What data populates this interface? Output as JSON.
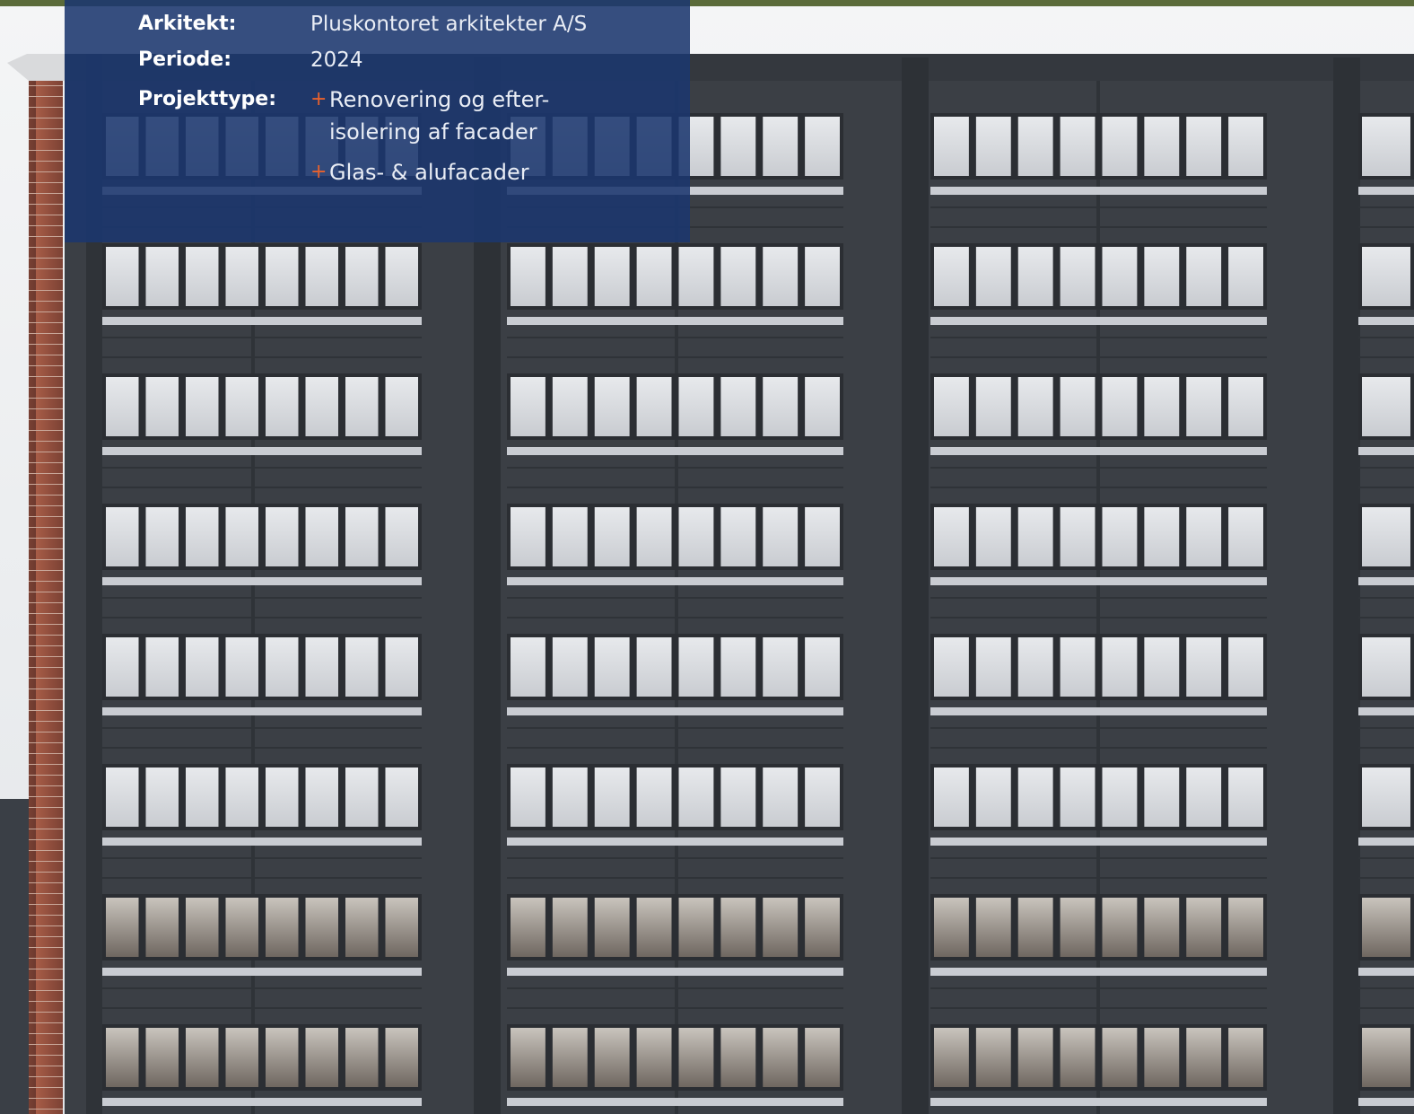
{
  "project": {
    "architect_label": "Arkitekt:",
    "architect_value": "Pluskontoret arkitekter A/S",
    "period_label": "Periode:",
    "period_value": "2024",
    "type_label": "Projekttype:",
    "type_items": [
      {
        "bullet": "+",
        "text_line1": "Renovering og efter-",
        "text_line2": "isolering af facader"
      },
      {
        "bullet": "+",
        "text_line1": "Glas- & alufacader"
      }
    ]
  },
  "colors": {
    "panel": "#1b376e",
    "accent_plus": "#e8612c",
    "facade_dark": "#3b3f45",
    "sky": "#eef0f2",
    "brick": "#8a4a3a"
  },
  "photo": {
    "subject": "building-facade-photo"
  }
}
